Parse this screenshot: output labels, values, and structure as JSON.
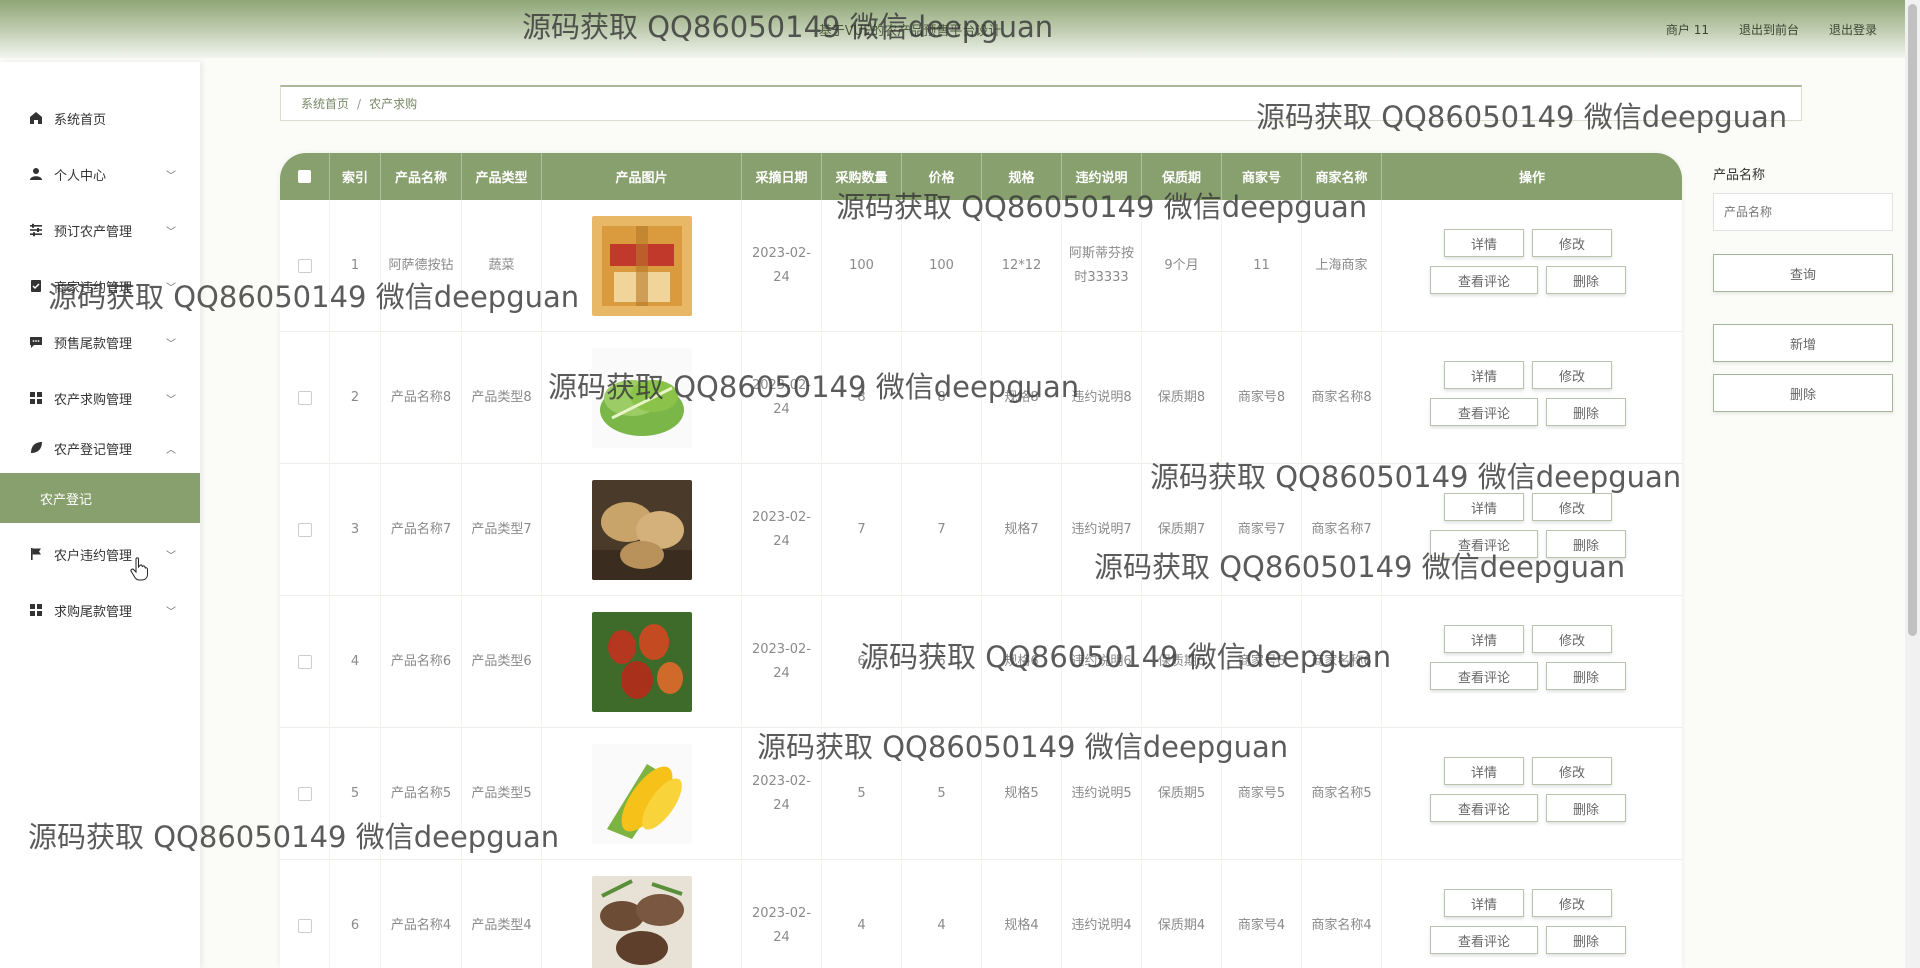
{
  "header": {
    "title": "基于VUE的农产品预售平台设计",
    "links": [
      "商户 11",
      "退出到前台",
      "退出登录"
    ]
  },
  "sidebar": {
    "items": [
      {
        "label": "系统首页",
        "icon": "home-icon",
        "chevron": ""
      },
      {
        "label": "个人中心",
        "icon": "user-icon",
        "chevron": "﹀"
      },
      {
        "label": "预订农产管理",
        "icon": "sliders-icon",
        "chevron": "﹀"
      },
      {
        "label": "商家违约管理",
        "icon": "clipboard-check-icon",
        "chevron": "﹀"
      },
      {
        "label": "预售尾款管理",
        "icon": "message-icon",
        "chevron": "﹀"
      },
      {
        "label": "农产求购管理",
        "icon": "grid-icon",
        "chevron": "﹀"
      },
      {
        "label": "农产登记管理",
        "icon": "leaf-icon",
        "chevron": "︿"
      },
      {
        "label": "农户违约管理",
        "icon": "flag-icon",
        "chevron": "﹀"
      },
      {
        "label": "求购尾款管理",
        "icon": "grid-icon",
        "chevron": "﹀"
      }
    ],
    "active_sub": "农产登记"
  },
  "breadcrumb": {
    "home": "系统首页",
    "sep": "/",
    "current": "农产求购"
  },
  "table": {
    "headers": [
      "索引",
      "产品名称",
      "产品类型",
      "产品图片",
      "采摘日期",
      "采购数量",
      "价格",
      "规格",
      "违约说明",
      "保质期",
      "商家号",
      "商家名称",
      "操作"
    ],
    "actions": {
      "detail": "详情",
      "edit": "修改",
      "comments": "查看评论",
      "delete": "删除"
    },
    "rows": [
      {
        "index": "1",
        "name": "阿萨德按钻",
        "type": "蔬菜",
        "image": "gift-box",
        "date": "2023-02-24",
        "qty": "100",
        "price": "100",
        "spec": "12*12",
        "breach": "阿斯蒂芬按时33333",
        "shelf": "9个月",
        "merchant_no": "11",
        "merchant_name": "上海商家"
      },
      {
        "index": "2",
        "name": "产品名称8",
        "type": "产品类型8",
        "image": "lettuce",
        "date": "2023-02-24",
        "qty": "8",
        "price": "8",
        "spec": "规格8",
        "breach": "违约说明8",
        "shelf": "保质期8",
        "merchant_no": "商家号8",
        "merchant_name": "商家名称8"
      },
      {
        "index": "3",
        "name": "产品名称7",
        "type": "产品类型7",
        "image": "potato",
        "date": "2023-02-24",
        "qty": "7",
        "price": "7",
        "spec": "规格7",
        "breach": "违约说明7",
        "shelf": "保质期7",
        "merchant_no": "商家号7",
        "merchant_name": "商家名称7"
      },
      {
        "index": "4",
        "name": "产品名称6",
        "type": "产品类型6",
        "image": "jujube",
        "date": "2023-02-24",
        "qty": "6",
        "price": "6",
        "spec": "规格6",
        "breach": "违约说明6",
        "shelf": "保质期6",
        "merchant_no": "商家号6",
        "merchant_name": "商家名称6"
      },
      {
        "index": "5",
        "name": "产品名称5",
        "type": "产品类型5",
        "image": "corn",
        "date": "2023-02-24",
        "qty": "5",
        "price": "5",
        "spec": "规格5",
        "breach": "违约说明5",
        "shelf": "保质期5",
        "merchant_no": "商家号5",
        "merchant_name": "商家名称5"
      },
      {
        "index": "6",
        "name": "产品名称4",
        "type": "产品类型4",
        "image": "mushroom",
        "date": "2023-02-24",
        "qty": "4",
        "price": "4",
        "spec": "规格4",
        "breach": "违约说明4",
        "shelf": "保质期4",
        "merchant_no": "商家号4",
        "merchant_name": "商家名称4"
      }
    ]
  },
  "search": {
    "label": "产品名称",
    "placeholder": "产品名称",
    "query_button": "查询",
    "add_button": "新增",
    "delete_button": "删除"
  },
  "watermark": "源码获取 QQ86050149 微信deepguan",
  "colors": {
    "accent": "#889f6e",
    "header_gradient_top": "#8fa676"
  }
}
